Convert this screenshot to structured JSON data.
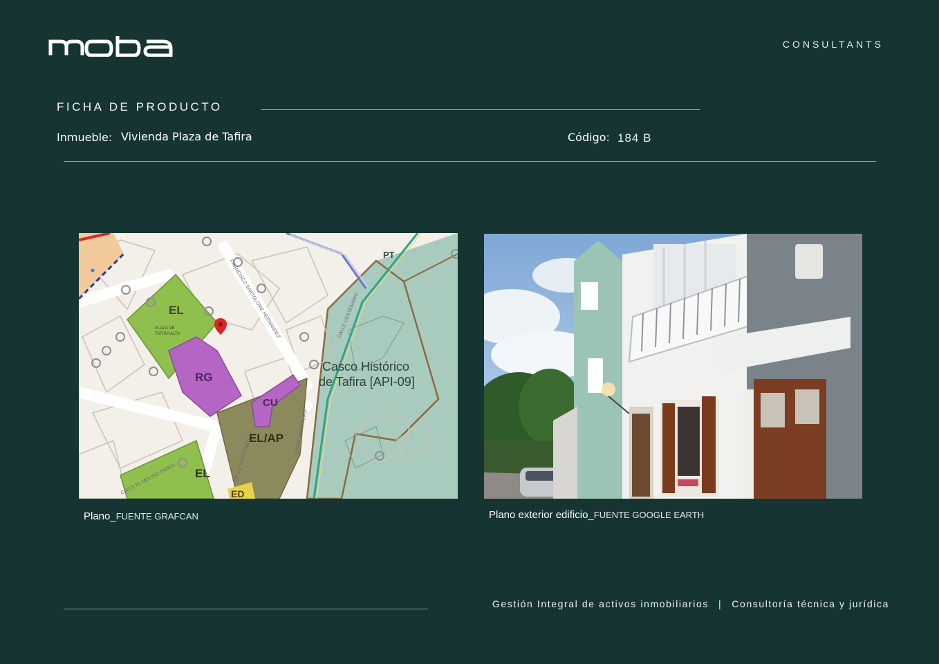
{
  "header": {
    "logo_text": "moba",
    "tagline": "CONSULTANTS"
  },
  "sheet": {
    "title": "FICHA DE PRODUCTO",
    "property_label": "Inmueble:",
    "property_value": "Vivienda Plaza de Tafira",
    "code_label": "Código:",
    "code_value": "184 B"
  },
  "map_panel": {
    "labels": {
      "el_top": "EL",
      "plaza": "PLAZA DE",
      "plaza_line2": "TAFIRA ALTA",
      "rg": "RG",
      "cu": "CU",
      "el_ap": "EL/AP",
      "el_bottom": "EL",
      "ed": "ED",
      "casco_line1": "Casco Histórico",
      "casco_line2": "de Tafira [API-09]",
      "street_francisco": "FRANCISCO BARTOLOMÉ HERNÁNDEZ",
      "street_centenario": "CALLE CENTENARIO",
      "street_molino": "CALLE EL MOLINO TAFIRA",
      "street_santa": "CALLE SANTA INÉS",
      "street_magnolias": "CALLE MAGNOLIAS",
      "pt": "PT"
    },
    "caption_main": "Plano_",
    "caption_source": "FUENTE GRAFCAN"
  },
  "photo_panel": {
    "caption_main": "Plano exterior edificio_",
    "caption_source": "FUENTE GOOGLE EARTH"
  },
  "footer": {
    "left": "Gestión Integral de activos inmobiliarios",
    "separator": "|",
    "right": "Consultoría técnica y jurídica"
  },
  "colors": {
    "background": "#163532",
    "map_green": "#8fbf4d",
    "map_purple": "#b565c4",
    "map_olive": "#8c8a5c",
    "map_historic": "#a9cbbd",
    "pin_red": "#d62828"
  },
  "icons": [
    "location-pin-icon"
  ]
}
